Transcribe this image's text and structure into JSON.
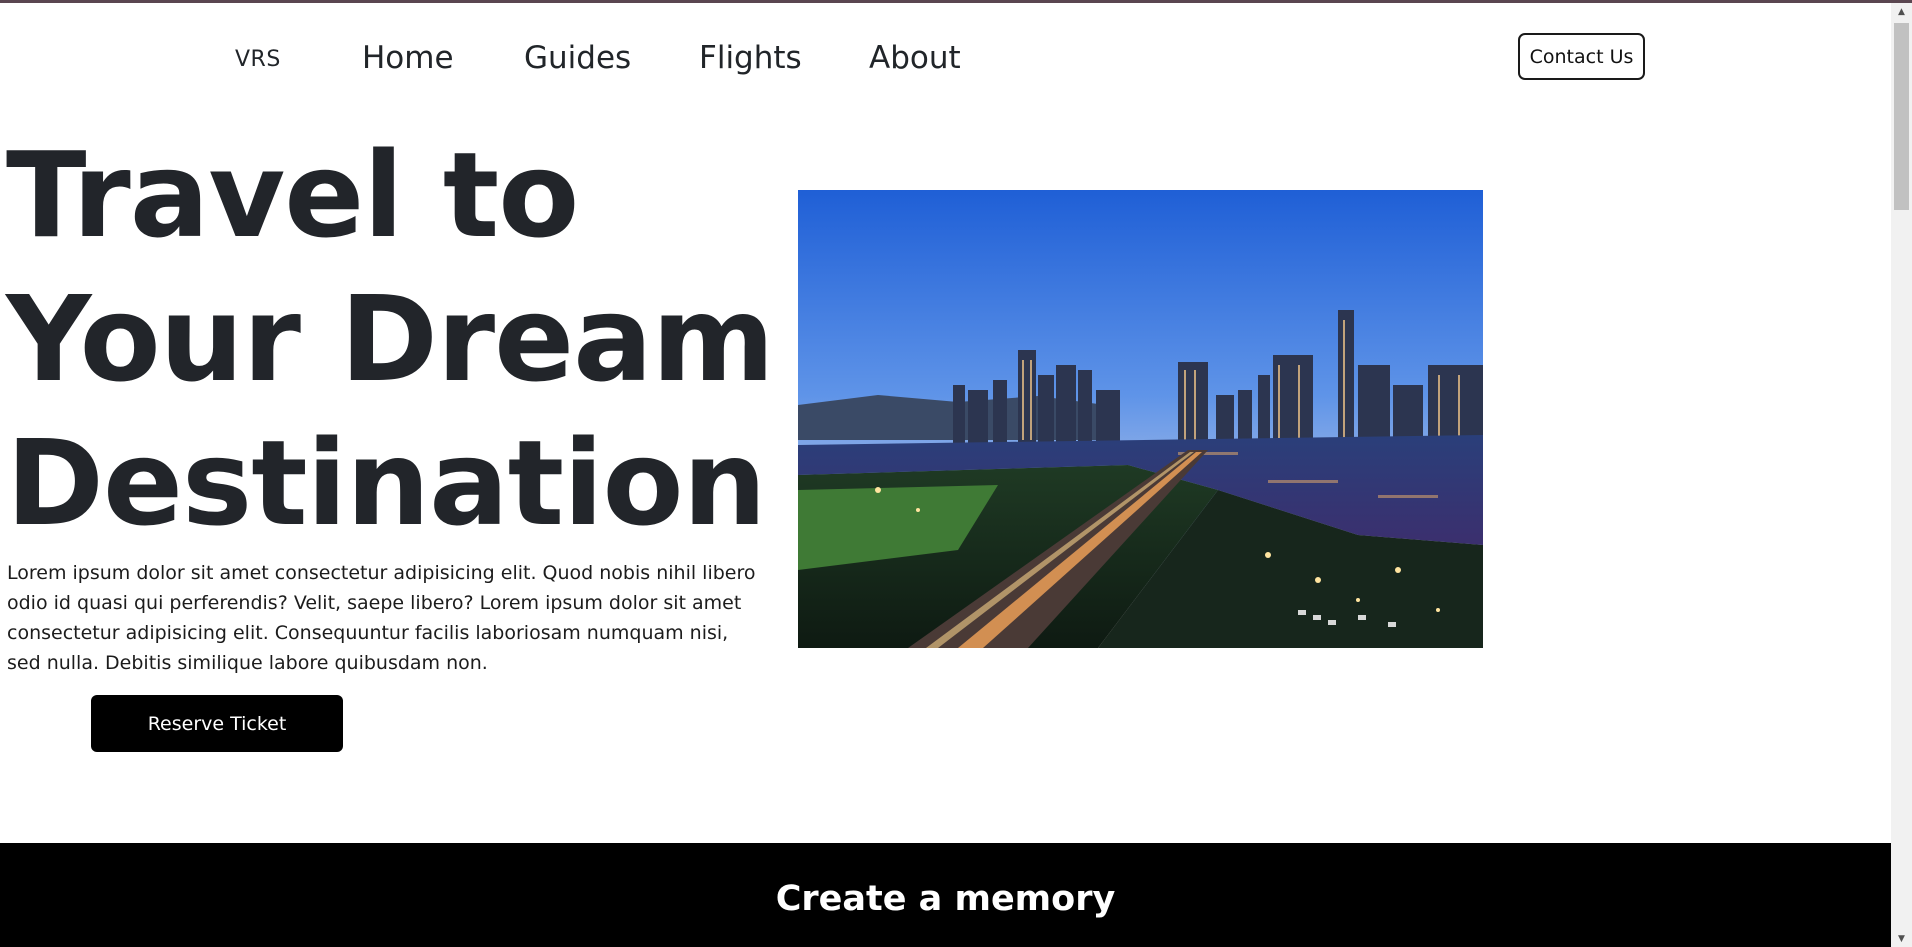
{
  "nav": {
    "brand": "VRS",
    "links": [
      "Home",
      "Guides",
      "Flights",
      "About"
    ],
    "contact_label": "Contact Us"
  },
  "hero": {
    "title_lines": [
      "Travel to",
      "Your Dream",
      "Destination"
    ],
    "description": "Lorem ipsum dolor sit amet consectetur adipisicing elit. Quod nobis nihil libero odio id quasi qui perferendis? Velit, saepe libero? Lorem ipsum dolor sit amet consectetur adipisicing elit. Consequuntur facilis laboriosam numquam nisi, sed nulla. Debitis similique labore quibusdam non.",
    "cta_label": "Reserve Ticket"
  },
  "section": {
    "title": "Create a memory"
  },
  "colors": {
    "accent_bar": "#5a4650",
    "text": "#212529",
    "button": "#000000"
  }
}
